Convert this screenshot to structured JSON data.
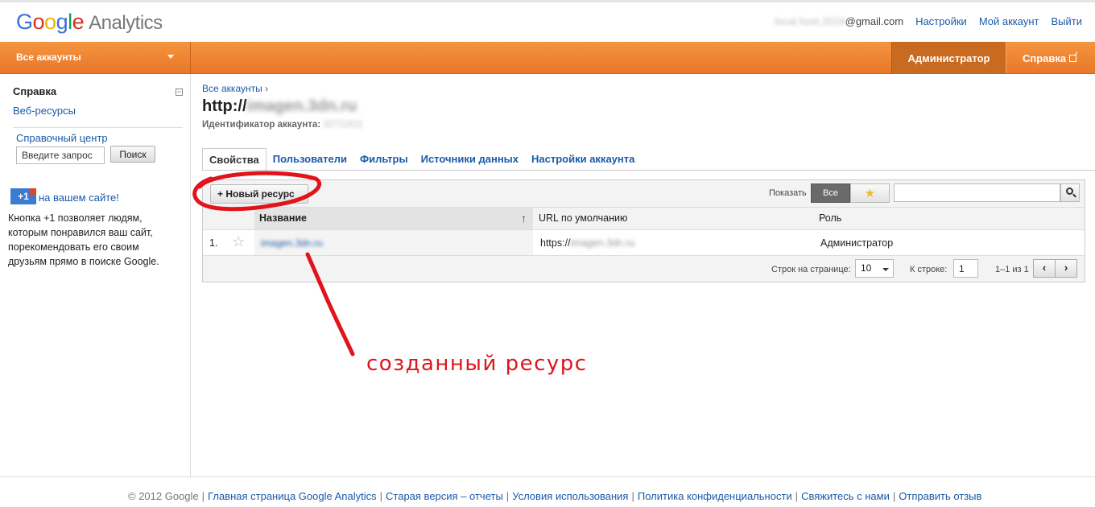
{
  "header": {
    "logo_google": "Google",
    "logo_product": "Analytics",
    "email_blurred": "local.host.2019",
    "email_domain": "@gmail.com",
    "settings": "Настройки",
    "my_account": "Мой аккаунт",
    "logout": "Выйти"
  },
  "nav": {
    "account_selector": "Все аккаунты",
    "admin": "Администратор",
    "help": "Справка"
  },
  "sidebar": {
    "title": "Справка",
    "collapse": "−",
    "link": "Веб-ресурсы",
    "help_center": "Справочный центр",
    "search_placeholder": "Введите запрос",
    "search_button": "Поиск",
    "plus_icon": "+1",
    "plus_title": "на вашем сайте!",
    "plus_text": "Кнопка +1 позволяет людям, которым понравился ваш сайт, порекомендовать его своим друзьям прямо в поиске Google."
  },
  "main": {
    "breadcrumb": "Все аккаунты",
    "breadcrumb_sep": "›",
    "title_prefix": "http://",
    "title_blurred": "imagen.3dn.ru",
    "account_id_label": "Идентификатор аккаунта:",
    "account_id_blurred": "32711611",
    "tabs": [
      {
        "label": "Свойства",
        "active": true
      },
      {
        "label": "Пользователи",
        "active": false
      },
      {
        "label": "Фильтры",
        "active": false
      },
      {
        "label": "Источники данных",
        "active": false
      },
      {
        "label": "Настройки аккаунта",
        "active": false
      }
    ]
  },
  "table": {
    "new_button": "+ Новый ресурс",
    "show_label": "Показать",
    "all_button": "Все",
    "star_button": "★",
    "columns": {
      "name": "Название",
      "url": "URL по умолчанию",
      "role": "Роль"
    },
    "sort_arrow": "↑",
    "rows": [
      {
        "num": "1.",
        "star": "☆",
        "name": "imagen.3dn.ru",
        "url_prefix": "https://",
        "url_blurred": "imagen.3dn.ru",
        "role": "Администратор"
      }
    ],
    "pager": {
      "rows_label": "Строк на странице:",
      "rows_value": "10",
      "goto_label": "К строке:",
      "goto_value": "1",
      "range": "1–1 из 1",
      "prev": "‹",
      "next": "›"
    }
  },
  "annotation": {
    "text": "созданный ресурс",
    "color": "#e0141a"
  },
  "footer": {
    "copyright": "© 2012 Google",
    "links": [
      "Главная страница Google Analytics",
      "Старая версия – отчеты",
      "Условия использования",
      "Политика конфиденциальности",
      "Свяжитесь с нами",
      "Отправить отзыв"
    ]
  }
}
